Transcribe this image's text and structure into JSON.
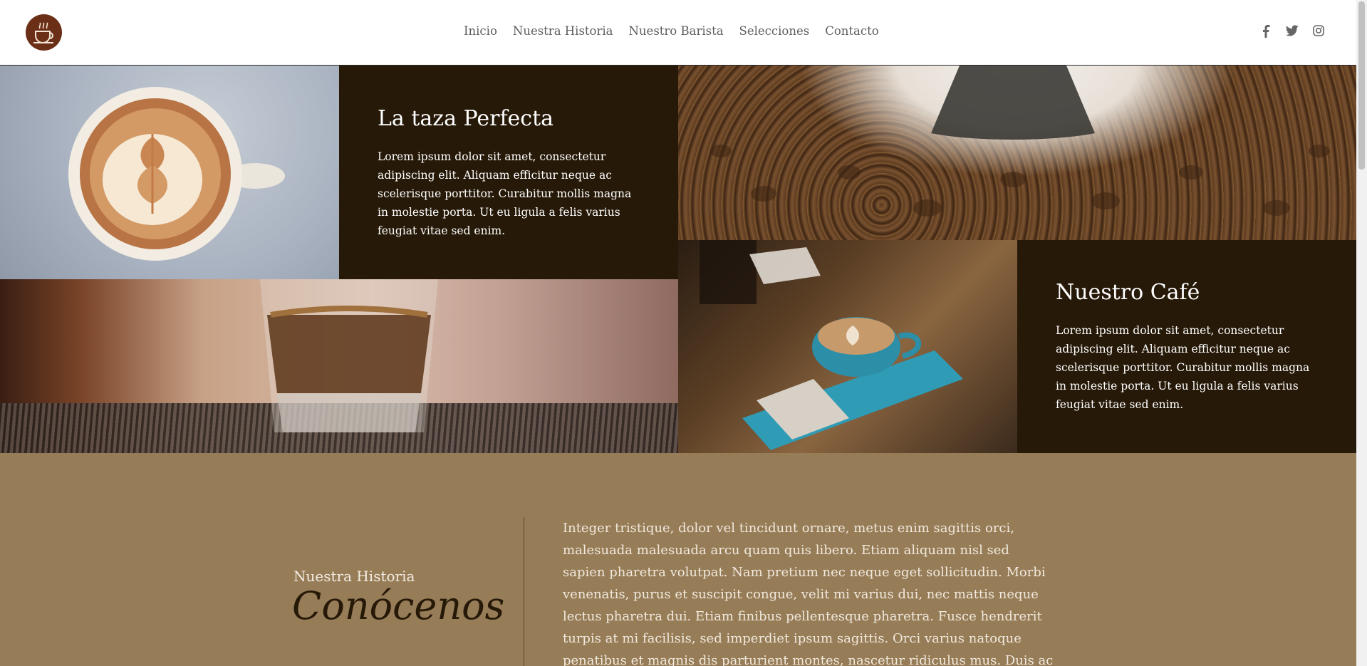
{
  "header": {
    "logo_name": "coffee-cup-logo",
    "nav": [
      "Inicio",
      "Nuestra Historia",
      "Nuestro Barista",
      "Selecciones",
      "Contacto"
    ],
    "social": [
      "facebook-icon",
      "twitter-icon",
      "instagram-icon"
    ]
  },
  "tiles": {
    "perfect_cup": {
      "title": "La taza Perfecta",
      "text": "Lorem ipsum dolor sit amet, consectetur adipiscing elit. Aliquam efficitur neque ac scelerisque porttitor. Curabitur mollis magna in molestie porta. Ut eu ligula a felis varius feugiat vitae sed enim."
    },
    "our_coffee": {
      "title": "Nuestro Café",
      "text": "Lorem ipsum dolor sit amet, consectetur adipiscing elit. Aliquam efficitur neque ac scelerisque porttitor. Curabitur mollis magna in molestie porta. Ut eu ligula a felis varius feugiat vitae sed enim."
    }
  },
  "story": {
    "kicker": "Nuestra Historia",
    "title": "Conócenos",
    "body": "Integer tristique, dolor vel tincidunt ornare, metus enim sagittis orci, malesuada malesuada arcu quam quis libero. Etiam aliquam nisl sed sapien pharetra volutpat. Nam pretium nec neque eget sollicitudin. Morbi venenatis, purus et suscipit congue, velit mi varius dui, nec mattis neque lectus pharetra dui. Etiam finibus pellentesque pharetra. Fusce hendrerit turpis at mi facilisis, sed imperdiet ipsum sagittis. Orci varius natoque penatibus et magnis dis parturient montes, nascetur ridiculus mus. Duis ac auctor sapien, quis congue"
  },
  "colors": {
    "dark_tile": "#261908",
    "story_bg": "#967c57",
    "logo_bg": "#6b2f17"
  }
}
